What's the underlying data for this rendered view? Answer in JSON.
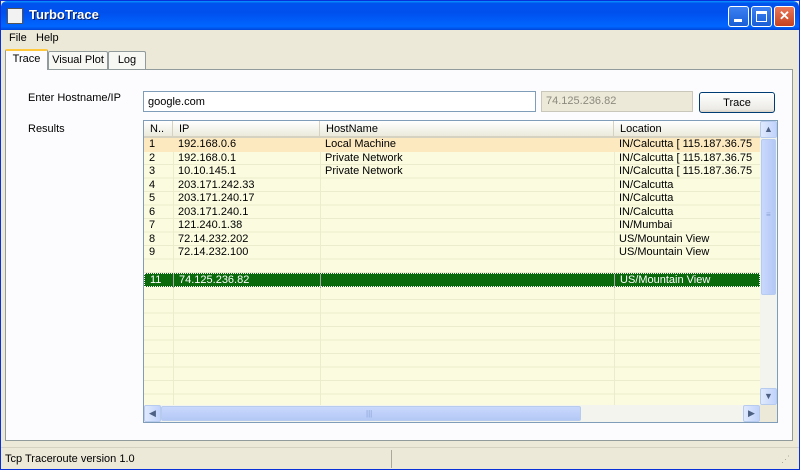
{
  "window": {
    "title": "TurboTrace"
  },
  "menu": {
    "items": [
      "File",
      "Help"
    ]
  },
  "tabs": [
    "Trace",
    "Visual Plot",
    "Log"
  ],
  "trace": {
    "hostname_label": "Enter Hostname/IP",
    "hostname_value": "google.com",
    "resolved_ip": "74.125.236.82",
    "trace_button": "Trace",
    "results_label": "Results"
  },
  "results": {
    "columns": [
      "N..",
      "IP",
      "HostName",
      "Location"
    ],
    "rows": [
      {
        "n": "1",
        "ip": "192.168.0.6",
        "host": "Local Machine",
        "location": "IN/Calcutta [ 115.187.36.75"
      },
      {
        "n": "2",
        "ip": "192.168.0.1",
        "host": "Private Network",
        "location": "IN/Calcutta [ 115.187.36.75"
      },
      {
        "n": "3",
        "ip": "10.10.145.1",
        "host": "Private Network",
        "location": "IN/Calcutta [ 115.187.36.75"
      },
      {
        "n": "4",
        "ip": "203.171.242.33",
        "host": "",
        "location": "IN/Calcutta"
      },
      {
        "n": "5",
        "ip": "203.171.240.17",
        "host": "",
        "location": "IN/Calcutta"
      },
      {
        "n": "6",
        "ip": "203.171.240.1",
        "host": "",
        "location": "IN/Calcutta"
      },
      {
        "n": "7",
        "ip": "121.240.1.38",
        "host": "",
        "location": "IN/Mumbai"
      },
      {
        "n": "8",
        "ip": "72.14.232.202",
        "host": "",
        "location": "US/Mountain View"
      },
      {
        "n": "9",
        "ip": "72.14.232.100",
        "host": "",
        "location": "US/Mountain View"
      },
      {
        "n": "",
        "ip": "",
        "host": "",
        "location": ""
      },
      {
        "n": "11",
        "ip": "74.125.236.82",
        "host": "",
        "location": "US/Mountain View"
      }
    ],
    "highlighted_row": 0,
    "selected_row": 10
  },
  "status": {
    "text": "Tcp Traceroute version 1.0"
  },
  "colors": {
    "title_bar": "#0054e3",
    "selected_row": "#0b6a0b",
    "row_band": "#fbfbe0",
    "highlight_row": "#fde9bf"
  }
}
